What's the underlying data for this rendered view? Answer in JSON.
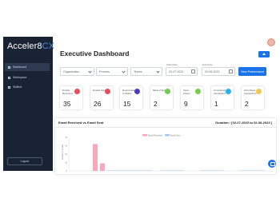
{
  "brand": {
    "name_a": "Acceler8",
    "name_b": "CX"
  },
  "sidebar": {
    "items": [
      {
        "label": "Dashboard",
        "active": true
      },
      {
        "label": "Workspace",
        "active": false
      },
      {
        "label": "Skillbot",
        "active": false
      }
    ],
    "logout_label": "Logout"
  },
  "header": {
    "title": "Executive Dashboard"
  },
  "filters": {
    "organization": "Organization",
    "process": "Process",
    "teams": "Teams",
    "start_label": "Start Date",
    "start_value": "02-07-2023",
    "end_label": "End Date",
    "end_value": "02-08-2023",
    "view_button": "View Performance"
  },
  "cards": [
    {
      "label": "Emails Received",
      "value": "35",
      "color": "#e94b5b"
    },
    {
      "label": "Emails Sent",
      "value": "26",
      "color": "#e94b5b"
    },
    {
      "label": "Responded to Within",
      "value": "15",
      "color": "#4d3bbf"
    },
    {
      "label": "Missed SLA",
      "value": "2",
      "color": "#6fcf4c"
    },
    {
      "label": "Open Cases",
      "value": "9",
      "color": "#6fcf4c"
    },
    {
      "label": "Unresolved Interactions",
      "value": "1",
      "color": "#27b4e5"
    },
    {
      "label": "First Reply Interactions",
      "value": "2",
      "color": "#f2c94c"
    }
  ],
  "chart_panel": {
    "title": "Email Received vs Email Sent",
    "duration": "Duration : [02-07-2023 to 02-08-2023 ]"
  },
  "chart_data": {
    "type": "bar",
    "series": [
      {
        "name": "Email Received",
        "color": "#f7a8bc"
      },
      {
        "name": "Email Sent",
        "color": "#9ec9f0"
      }
    ],
    "y_ticks": [
      "40",
      "30",
      "20",
      "10",
      "0"
    ],
    "ylabel": "Number of Emails",
    "bars": [
      {
        "series": "Email Received",
        "value": 32
      },
      {
        "series": "Email Received",
        "value": 9
      }
    ]
  }
}
